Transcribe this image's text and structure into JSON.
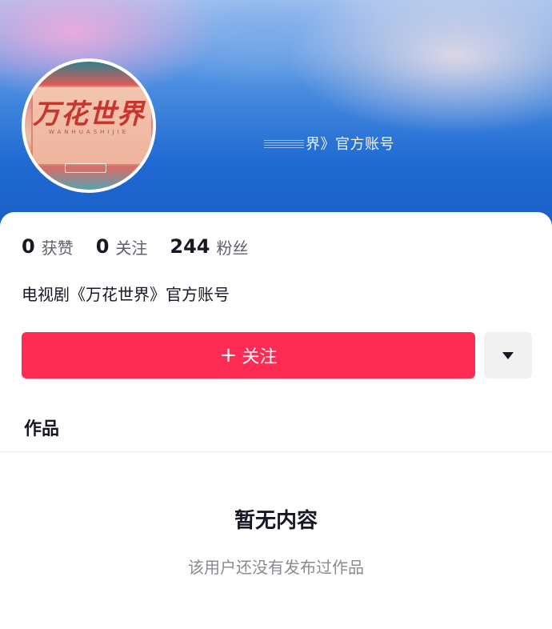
{
  "profile": {
    "banner_text": "界》官方账号",
    "avatar_title": "万花世界",
    "avatar_subtitle": "WANHUASHIJIE",
    "bio": "电视剧《万花世界》官方账号"
  },
  "stats": [
    {
      "num": "0",
      "label": "获赞"
    },
    {
      "num": "0",
      "label": "关注"
    },
    {
      "num": "244",
      "label": "粉丝"
    }
  ],
  "actions": {
    "follow_icon": "+",
    "follow_label": "关注",
    "more_icon": "caret-down-icon"
  },
  "tabs": {
    "works_label": "作品"
  },
  "empty_state": {
    "title": "暂无内容",
    "description": "该用户还没有发布过作品"
  },
  "colors": {
    "follow_button": "#fe2c55",
    "banner_blue": "#1f6ad2"
  }
}
